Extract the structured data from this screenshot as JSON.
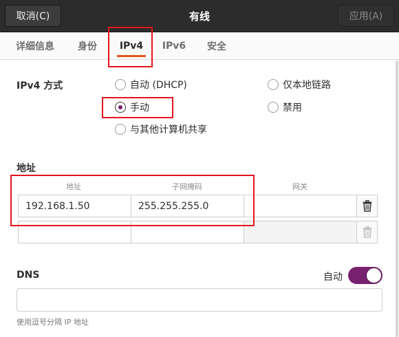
{
  "header": {
    "cancel_label": "取消(C)",
    "title": "有线",
    "apply_label": "应用(A)"
  },
  "tabs": [
    {
      "label": "详细信息"
    },
    {
      "label": "身份"
    },
    {
      "label": "IPv4"
    },
    {
      "label": "IPv6"
    },
    {
      "label": "安全"
    }
  ],
  "active_tab": "IPv4",
  "ipv4_method": {
    "label": "IPv4 方式",
    "options": {
      "auto_dhcp": "自动 (DHCP)",
      "link_local": "仅本地链路",
      "manual": "手动",
      "disabled": "禁用",
      "shared": "与其他计算机共享"
    },
    "selected": "手动"
  },
  "addresses": {
    "label": "地址",
    "columns": [
      "地址",
      "子网掩码",
      "网关"
    ],
    "rows": [
      {
        "address": "192.168.1.50",
        "netmask": "255.255.255.0",
        "gateway": ""
      },
      {
        "address": "",
        "netmask": "",
        "gateway": ""
      }
    ]
  },
  "dns": {
    "label": "DNS",
    "auto_label": "自动",
    "auto_enabled": true,
    "value": "",
    "hint": "使用逗号分隔 IP 地址"
  },
  "colors": {
    "accent": "#e95420",
    "toggle_on": "#77216f",
    "header_bg": "#2c2c2c",
    "highlight": "#e4151d"
  }
}
